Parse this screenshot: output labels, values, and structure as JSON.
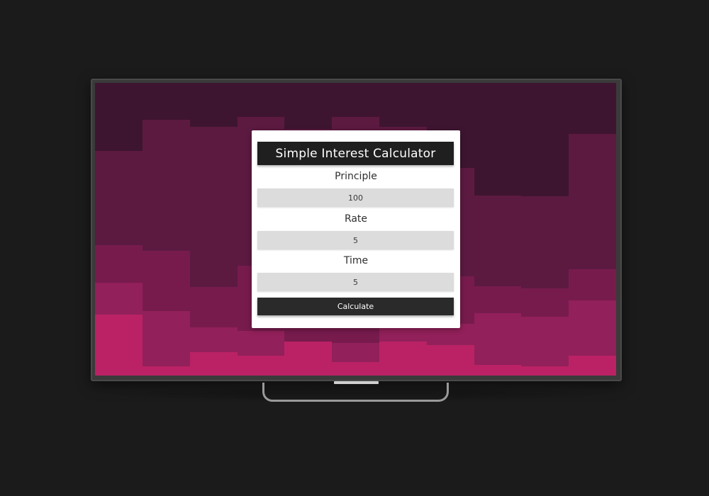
{
  "calculator": {
    "title": "Simple Interest Calculator",
    "principle": {
      "label": "Principle",
      "value": "100"
    },
    "rate": {
      "label": "Rate",
      "value": "5"
    },
    "time": {
      "label": "Time",
      "value": "5"
    },
    "calculate_label": "Calculate"
  },
  "colors": {
    "page_background": "#1b1b1b",
    "screen_shades": [
      "#3e1530",
      "#5c1a41",
      "#771b4d",
      "#92205a",
      "#ba2265"
    ],
    "title_bar": "#1f1f1f",
    "input_background": "#dcdcdc",
    "button": "#2a2a2a"
  }
}
